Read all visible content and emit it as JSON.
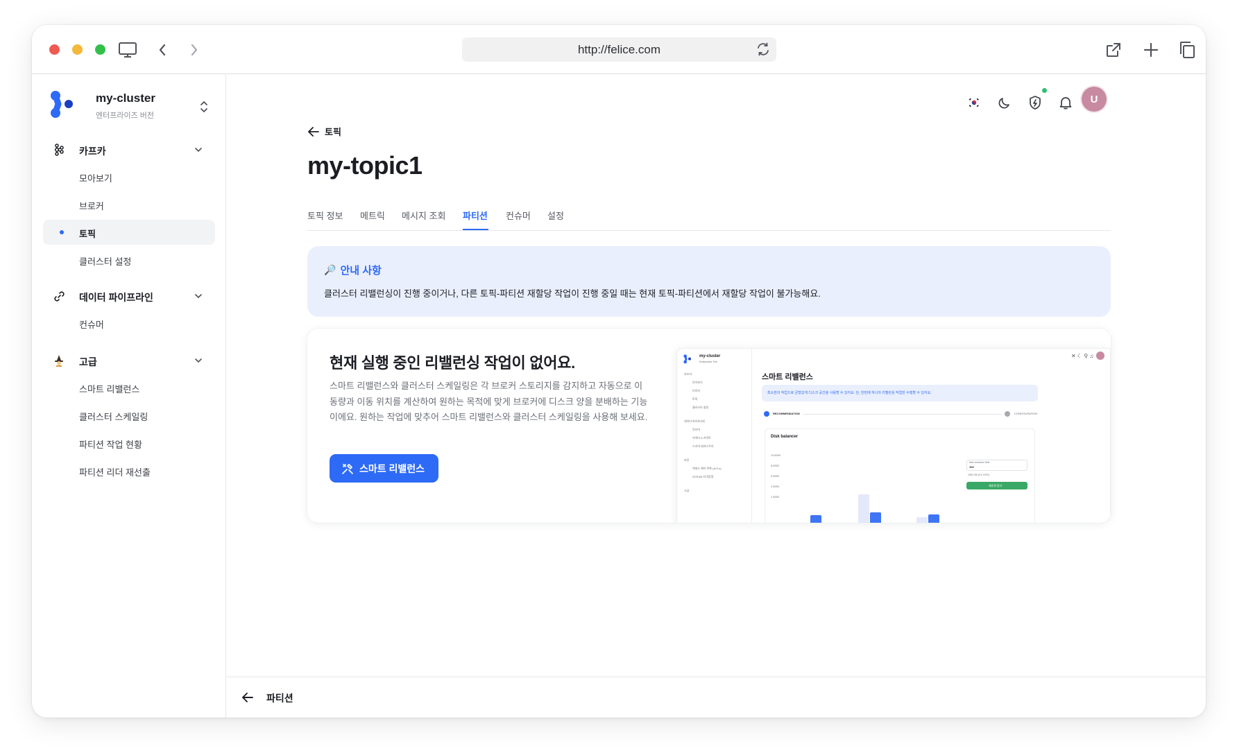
{
  "browser": {
    "url": "http://felice.com"
  },
  "sidebar": {
    "cluster_name": "my-cluster",
    "cluster_edition": "엔터프라이즈 버전",
    "sections": [
      {
        "label": "카프카",
        "icon": "kafka-icon",
        "items": [
          "모아보기",
          "브로커",
          "토픽",
          "클러스터 설정"
        ]
      },
      {
        "label": "데이터 파이프라인",
        "icon": "link-icon",
        "items": [
          "컨슈머"
        ]
      },
      {
        "label": "고급",
        "icon": "wizard-icon",
        "items": [
          "스마트 리밸런스",
          "클러스터 스케일링",
          "파티션 작업 현황",
          "파티션 리더 재선출"
        ]
      }
    ],
    "active_item": "토픽"
  },
  "header": {
    "language_flag": "🇰🇷",
    "avatar_initial": "U"
  },
  "page": {
    "back_label": "토픽",
    "title": "my-topic1",
    "tabs": [
      "토픽 정보",
      "메트릭",
      "메시지 조회",
      "파티션",
      "컨슈머",
      "설정"
    ],
    "active_tab": "파티션"
  },
  "notice": {
    "icon": "🔎",
    "title": "안내 사항",
    "body": "클러스터 리밸런싱이 진행 중이거나, 다른 토픽-파티션 재할당 작업이 진행 중일 때는 현재 토픽-파티션에서 재할당 작업이 불가능해요."
  },
  "empty_state": {
    "title": "현재 실행 중인 리밸런싱 작업이 없어요.",
    "description": "스마트 리밸런스와 클러스터 스케일링은 각 브로커 스토리지를 감지하고 자동으로 이동량과 이동 위치를 계산하여 원하는 목적에 맞게 브로커에 디스크 양을 분배하는 기능이에요. 원하는 작업에 맞추어 스마트 리밸런스와 클러스터 스케일링을 사용해 보세요.",
    "button_label": "스마트 리밸런스"
  },
  "preview": {
    "cluster_name": "my-cluster",
    "cluster_sub": "Enterprise Tier",
    "page_title": "스마트 리밸런스",
    "notice": "최소한의 작업으로 균형있게 디스크 공간을 사용할 수 있어요. 단, 한번에 하나의 리밸런싱 작업만 수행할 수 있어요.",
    "step1": "RECOMMENDATION",
    "step2": "CONFIGURATION",
    "chart_title": "Disk balancer",
    "y_ticks": [
      "10.00GB",
      "8.00GB",
      "6.00GB",
      "4.00GB",
      "2.00GB"
    ],
    "field_label": "Max recursion limit",
    "field_value": "100",
    "field_hint": "1962 GB (0.0 1976)",
    "action_button": "재추천 받기",
    "side_items": [
      "카프카",
      "모아보기",
      "브로커",
      "토픽",
      "클러스터 설정",
      "데이터 파이프라인",
      "컨슈머",
      "커넥터 & 커넥트",
      "스키마 레지스트리",
      "보안",
      "액세스 제어 목록 (ACLs)",
      "SCRAM 자격증명",
      "고급"
    ],
    "bars_before": [
      0.25,
      1.0,
      0.5
    ],
    "bars_after": [
      0.55,
      0.6,
      0.56
    ]
  },
  "bottom_bar": {
    "label": "파티션"
  },
  "colors": {
    "accent": "#2d6af6",
    "notice_bg": "#eaeffd",
    "avatar": "#c78aa0",
    "status_dot": "#2fbf71"
  }
}
